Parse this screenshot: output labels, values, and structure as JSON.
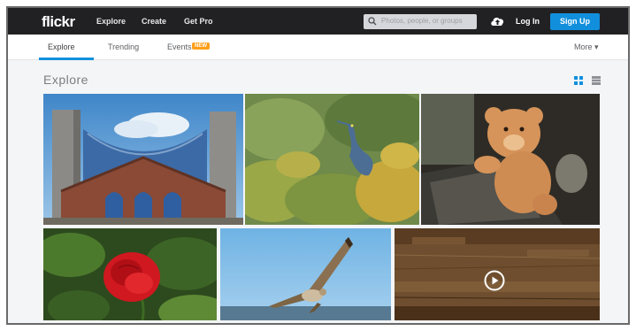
{
  "topbar": {
    "logo": "flickr",
    "nav": [
      "Explore",
      "Create",
      "Get Pro"
    ],
    "search_placeholder": "Photos, people, or groups",
    "login_label": "Log In",
    "signup_label": "Sign Up"
  },
  "subnav": {
    "tabs": [
      "Explore",
      "Trending",
      "Events"
    ],
    "events_badge": "NEW",
    "more_label": "More ▾"
  },
  "page": {
    "title": "Explore"
  },
  "photos": [
    "modern-church-building",
    "blue-heron-in-foliage",
    "teddy-bear-on-rail",
    "red-rose",
    "hawk-in-flight",
    "wooden-video-thumbnail"
  ],
  "colors": {
    "topbar_bg": "#212124",
    "accent": "#128fdc",
    "badge": "#ff9f1a"
  }
}
